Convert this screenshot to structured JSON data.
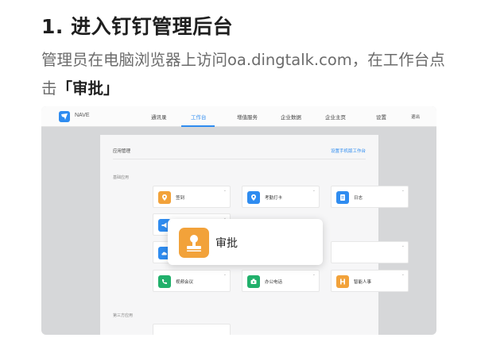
{
  "heading": "1. 进入钉钉管理后台",
  "description": {
    "prefix": "管理员在电脑浏览器上访问oa.dingtalk.com，在工作台点击",
    "highlight": "「审批」"
  },
  "app": {
    "brand": "NAVE",
    "nav": [
      {
        "label": "通讯录",
        "active": false
      },
      {
        "label": "工作台",
        "active": true
      },
      {
        "label": "增值服务",
        "active": false
      },
      {
        "label": "企业数据",
        "active": false
      },
      {
        "label": "企业主页",
        "active": false
      },
      {
        "label": "设置",
        "active": false
      },
      {
        "label": "退出",
        "active": false
      }
    ],
    "panel": {
      "title": "应用管理",
      "link": "设置手机版工作台",
      "section_basic": "基础应用",
      "section_third": "第三方应用",
      "apps": [
        {
          "label": "签到",
          "color": "#f2a23a",
          "icon": "location-pin-icon"
        },
        {
          "label": "考勤打卡",
          "color": "#2f8cf0",
          "icon": "location-pin-icon"
        },
        {
          "label": "日志",
          "color": "#2f8cf0",
          "icon": "log-book-icon"
        },
        {
          "label": "公告",
          "color": "#2f8cf0",
          "icon": "megaphone-icon"
        },
        {
          "label": "钉盘",
          "color": "#2f8cf0",
          "icon": "cloud-icon"
        },
        {
          "label": "视频会议",
          "color": "#21b06b",
          "icon": "video-call-icon"
        },
        {
          "label": "办公电话",
          "color": "#21b06b",
          "icon": "phone-icon"
        },
        {
          "label": "智能人事",
          "color": "#f2a23a",
          "icon": "hr-icon"
        }
      ]
    },
    "popup": {
      "label": "审批",
      "color": "#f2a23a",
      "icon": "approval-stamp-icon"
    }
  }
}
